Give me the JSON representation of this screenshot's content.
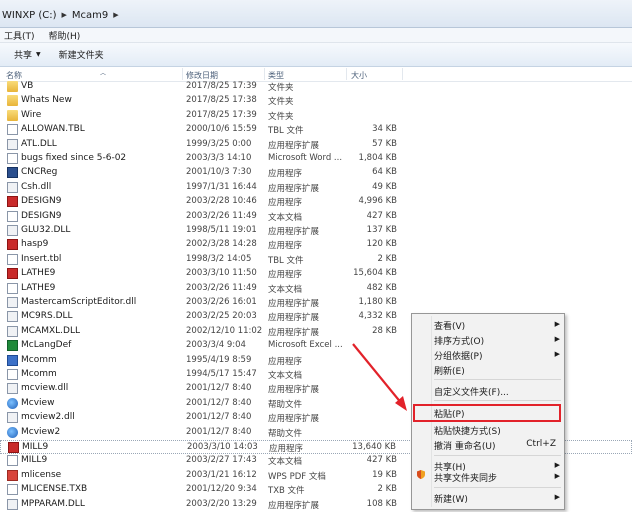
{
  "address": {
    "drive": "WINXP (C:)",
    "folder": "Mcam9"
  },
  "menubar": {
    "tools": "工具(T)",
    "help": "帮助(H)"
  },
  "toolbar": {
    "share": "共享",
    "new_folder": "新建文件夹"
  },
  "columns": {
    "name": "名称",
    "date": "修改日期",
    "type": "类型",
    "size": "大小"
  },
  "files": [
    {
      "name": "VB",
      "date": "2017/8/25 17:39",
      "type": "文件夹",
      "size": "",
      "icon": "folder"
    },
    {
      "name": "Whats New",
      "date": "2017/8/25 17:38",
      "type": "文件夹",
      "size": "",
      "icon": "folder"
    },
    {
      "name": "Wire",
      "date": "2017/8/25 17:39",
      "type": "文件夹",
      "size": "",
      "icon": "folder"
    },
    {
      "name": "ALLOWAN.TBL",
      "date": "2000/10/6 15:59",
      "type": "TBL 文件",
      "size": "34 KB",
      "icon": "doc"
    },
    {
      "name": "ATL.DLL",
      "date": "1999/3/25 0:00",
      "type": "应用程序扩展",
      "size": "57 KB",
      "icon": "dll"
    },
    {
      "name": "bugs fixed since 5-6-02",
      "date": "2003/3/3 14:10",
      "type": "Microsoft Word ...",
      "size": "1,804 KB",
      "icon": "doc"
    },
    {
      "name": "CNCReg",
      "date": "2001/10/3 7:30",
      "type": "应用程序",
      "size": "64 KB",
      "icon": "app"
    },
    {
      "name": "Csh.dll",
      "date": "1997/1/31 16:44",
      "type": "应用程序扩展",
      "size": "49 KB",
      "icon": "dll"
    },
    {
      "name": "DESIGN9",
      "date": "2003/2/28 10:46",
      "type": "应用程序",
      "size": "4,996 KB",
      "icon": "red"
    },
    {
      "name": "DESIGN9",
      "date": "2003/2/26 11:49",
      "type": "文本文档",
      "size": "427 KB",
      "icon": "doc"
    },
    {
      "name": "GLU32.DLL",
      "date": "1998/5/11 19:01",
      "type": "应用程序扩展",
      "size": "137 KB",
      "icon": "dll"
    },
    {
      "name": "hasp9",
      "date": "2002/3/28 14:28",
      "type": "应用程序",
      "size": "120 KB",
      "icon": "red"
    },
    {
      "name": "Insert.tbl",
      "date": "1998/3/2 14:05",
      "type": "TBL 文件",
      "size": "2 KB",
      "icon": "doc"
    },
    {
      "name": "LATHE9",
      "date": "2003/3/10 11:50",
      "type": "应用程序",
      "size": "15,604 KB",
      "icon": "red"
    },
    {
      "name": "LATHE9",
      "date": "2003/2/26 11:49",
      "type": "文本文档",
      "size": "482 KB",
      "icon": "doc"
    },
    {
      "name": "MastercamScriptEditor.dll",
      "date": "2003/2/26 16:01",
      "type": "应用程序扩展",
      "size": "1,180 KB",
      "icon": "dll"
    },
    {
      "name": "MC9RS.DLL",
      "date": "2003/2/25 20:03",
      "type": "应用程序扩展",
      "size": "4,332 KB",
      "icon": "dll"
    },
    {
      "name": "MCAMXL.DLL",
      "date": "2002/12/10 11:02",
      "type": "应用程序扩展",
      "size": "28 KB",
      "icon": "dll"
    },
    {
      "name": "McLangDef",
      "date": "2003/3/4 9:04",
      "type": "Microsoft Excel ...",
      "size": "",
      "icon": "excel"
    },
    {
      "name": "Mcomm",
      "date": "1995/4/19 8:59",
      "type": "应用程序",
      "size": "",
      "icon": "blue"
    },
    {
      "name": "Mcomm",
      "date": "1994/5/17 15:47",
      "type": "文本文档",
      "size": "",
      "icon": "doc"
    },
    {
      "name": "mcview.dll",
      "date": "2001/12/7 8:40",
      "type": "应用程序扩展",
      "size": "",
      "icon": "dll"
    },
    {
      "name": "Mcview",
      "date": "2001/12/7 8:40",
      "type": "帮助文件",
      "size": "",
      "icon": "globe"
    },
    {
      "name": "mcview2.dll",
      "date": "2001/12/7 8:40",
      "type": "应用程序扩展",
      "size": "",
      "icon": "dll"
    },
    {
      "name": "Mcview2",
      "date": "2001/12/7 8:40",
      "type": "帮助文件",
      "size": "",
      "icon": "globe"
    },
    {
      "name": "MILL9",
      "date": "2003/3/10 14:03",
      "type": "应用程序",
      "size": "13,640 KB",
      "icon": "red",
      "selected": true
    },
    {
      "name": "MILL9",
      "date": "2003/2/27 17:43",
      "type": "文本文档",
      "size": "427 KB",
      "icon": "doc"
    },
    {
      "name": "mlicense",
      "date": "2003/1/21 16:12",
      "type": "WPS PDF 文档",
      "size": "19 KB",
      "icon": "wps"
    },
    {
      "name": "MLICENSE.TXB",
      "date": "2001/12/20 9:34",
      "type": "TXB 文件",
      "size": "2 KB",
      "icon": "doc"
    },
    {
      "name": "MPPARAM.DLL",
      "date": "2003/2/20 13:29",
      "type": "应用程序扩展",
      "size": "108 KB",
      "icon": "dll"
    }
  ],
  "context_menu": {
    "view": "查看(V)",
    "sort": "排序方式(O)",
    "group": "分组依据(P)",
    "refresh": "刷新(E)",
    "customize": "自定义文件夹(F)...",
    "paste": "粘贴(P)",
    "paste_shortcut": "粘贴快捷方式(S)",
    "undo_rename": "撤消 重命名(U)",
    "undo_shortcut": "Ctrl+Z",
    "share": "共享(H)",
    "share_sync": "共享文件夹同步",
    "new": "新建(W)"
  },
  "colors": {
    "highlight": "#e2222a",
    "arrow": "#e2222a"
  }
}
